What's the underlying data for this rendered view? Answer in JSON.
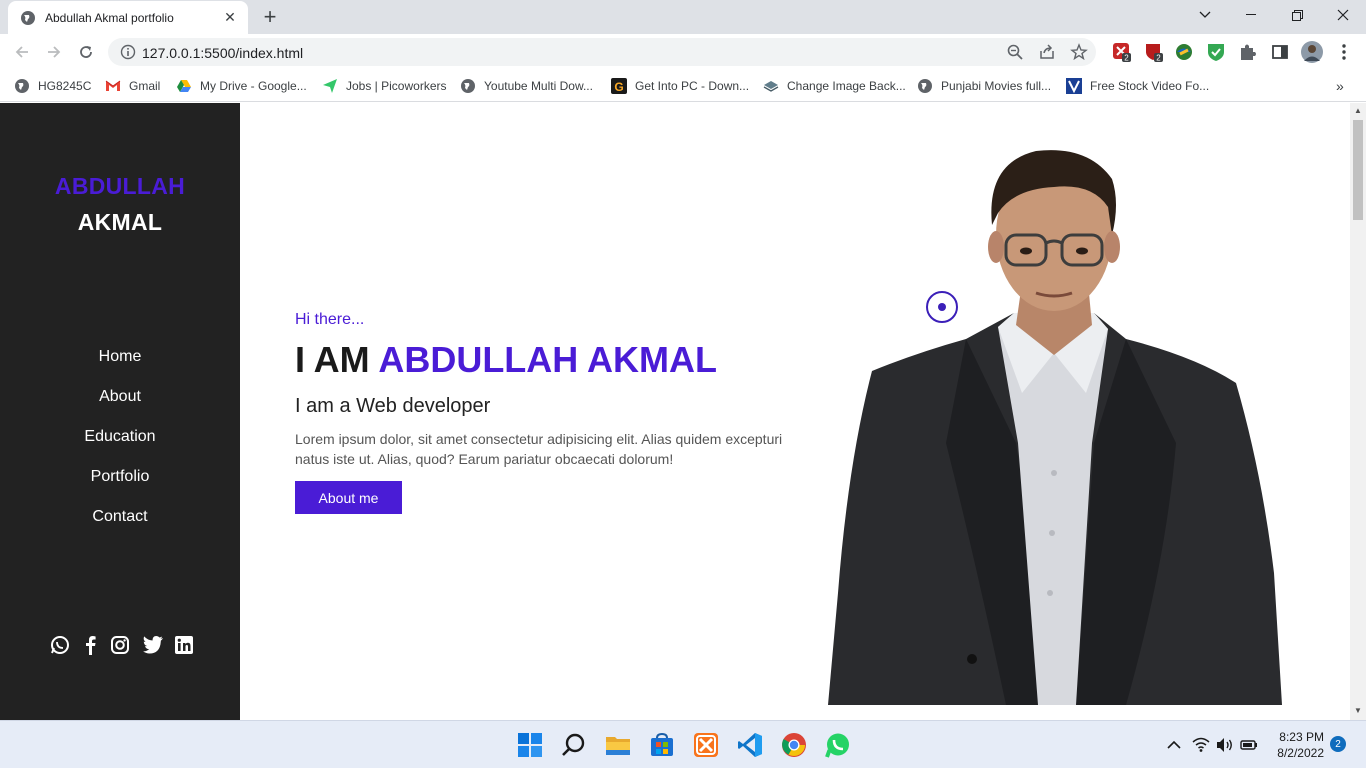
{
  "browser": {
    "tab_title": "Abdullah Akmal portfolio",
    "url": "127.0.0.1:5500/index.html",
    "extension_badges": [
      "2",
      "2"
    ],
    "bookmarks": [
      {
        "label": "HG8245C",
        "icon": "globe-icon"
      },
      {
        "label": "Gmail",
        "icon": "gmail-icon"
      },
      {
        "label": "My Drive - Google...",
        "icon": "drive-icon"
      },
      {
        "label": "Jobs | Picoworkers",
        "icon": "picoworkers-icon"
      },
      {
        "label": "Youtube Multi Dow...",
        "icon": "globe-icon"
      },
      {
        "label": "Get Into PC - Down...",
        "icon": "getintopc-icon"
      },
      {
        "label": "Change Image Back...",
        "icon": "layers-icon"
      },
      {
        "label": "Punjabi Movies full...",
        "icon": "globe-icon"
      },
      {
        "label": "Free Stock Video Fo...",
        "icon": "videvo-icon"
      }
    ]
  },
  "sidebar": {
    "brand_first": "ABDULLAH",
    "brand_last": "AKMAL",
    "nav": [
      "Home",
      "About",
      "Education",
      "Portfolio",
      "Contact"
    ],
    "social_icons": [
      "whatsapp-icon",
      "facebook-icon",
      "instagram-icon",
      "twitter-icon",
      "linkedin-icon"
    ]
  },
  "hero": {
    "greeting": "Hi there...",
    "iam_prefix": "I AM",
    "name": "ABDULLAH AKMAL",
    "role": "I am a Web developer",
    "description": "Lorem ipsum dolor, sit amet consectetur adipisicing elit. Alias quidem excepturi natus iste ut. Alias, quod? Earum pariatur obcaecati dolorum!",
    "button_label": "About me"
  },
  "colors": {
    "accent": "#4a1cd6",
    "sidebar_bg": "#222222"
  },
  "taskbar": {
    "time": "8:23 PM",
    "date": "8/2/2022",
    "notification_count": "2"
  }
}
